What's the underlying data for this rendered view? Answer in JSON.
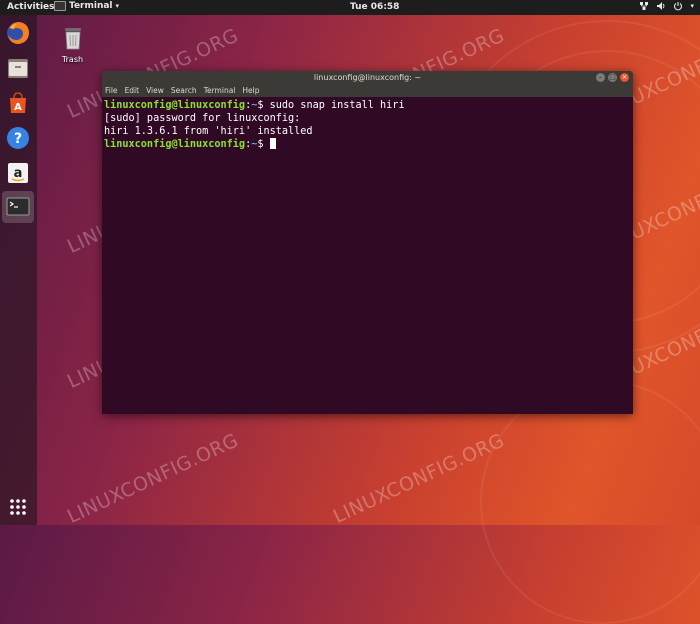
{
  "topbar": {
    "activities": "Activities",
    "app_name": "Terminal",
    "clock": "Tue 06:58"
  },
  "desktop": {
    "trash_label": "Trash",
    "watermark": "LINUXCONFIG.ORG"
  },
  "terminal": {
    "title": "linuxconfig@linuxconfig: ~",
    "menu": [
      "File",
      "Edit",
      "View",
      "Search",
      "Terminal",
      "Help"
    ],
    "lines": [
      {
        "user": "linuxconfig@linuxconfig",
        "path": "~",
        "command": "sudo snap install hiri"
      },
      {
        "text": "[sudo] password for linuxconfig:"
      },
      {
        "text": "hiri 1.3.6.1 from 'hiri' installed"
      },
      {
        "user": "linuxconfig@linuxconfig",
        "path": "~",
        "command": ""
      }
    ]
  },
  "colors": {
    "terminal_bg": "#300a24",
    "prompt_user": "#8ae234",
    "prompt_path": "#729fcf",
    "accent": "#e9542a"
  }
}
